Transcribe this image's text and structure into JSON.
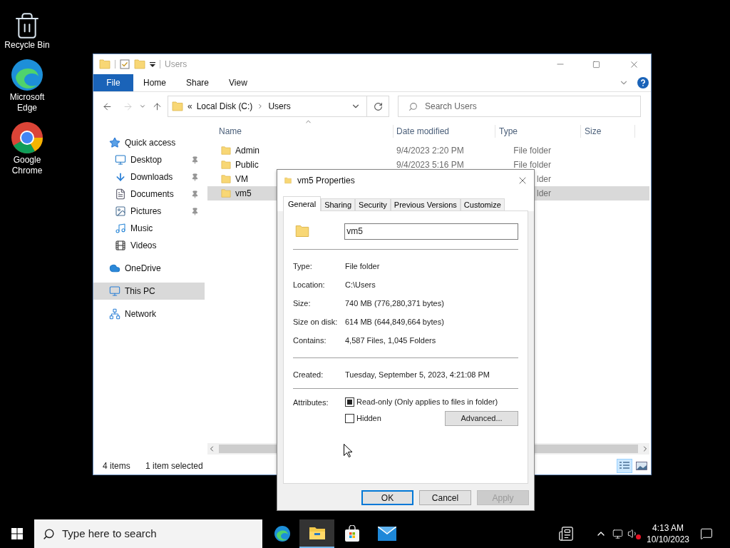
{
  "desktop_icons": [
    {
      "kind": "bin",
      "label": "Recycle Bin"
    },
    {
      "kind": "edge",
      "label": "Microsoft Edge"
    },
    {
      "kind": "chrome",
      "label": "Google Chrome"
    }
  ],
  "explorer": {
    "title": "Users",
    "ribbon_tabs": [
      {
        "label": "File",
        "kind": "file"
      },
      {
        "label": "Home",
        "kind": "tab"
      },
      {
        "label": "Share",
        "kind": "tab"
      },
      {
        "label": "View",
        "kind": "tab"
      }
    ],
    "breadcrumb_overflow": "«",
    "breadcrumb": [
      "Local Disk (C:)",
      "Users"
    ],
    "search": {
      "placeholder": "Search Users"
    },
    "columns": [
      "Name",
      "Date modified",
      "Type",
      "Size"
    ],
    "sidebar": [
      {
        "label": "Quick access",
        "kind": "star",
        "selected": false,
        "pinned": false,
        "children": [
          {
            "label": "Desktop",
            "kind": "desktop",
            "selected": false,
            "pinned": true
          },
          {
            "label": "Downloads",
            "kind": "download",
            "selected": false,
            "pinned": true
          },
          {
            "label": "Documents",
            "kind": "document",
            "selected": false,
            "pinned": true
          },
          {
            "label": "Pictures",
            "kind": "picture",
            "selected": false,
            "pinned": true
          },
          {
            "label": "Music",
            "kind": "music",
            "selected": false,
            "pinned": false
          },
          {
            "label": "Videos",
            "kind": "video",
            "selected": false,
            "pinned": false
          }
        ]
      },
      {
        "label": "OneDrive",
        "kind": "cloud",
        "selected": false,
        "pinned": false
      },
      {
        "label": "This PC",
        "kind": "pc",
        "selected": true,
        "pinned": false
      },
      {
        "label": "Network",
        "kind": "network",
        "selected": false,
        "pinned": false
      }
    ],
    "rows": [
      {
        "name": "Admin",
        "date_modified": "9/4/2023 2:20 PM",
        "type": "File folder",
        "selected": false
      },
      {
        "name": "Public",
        "date_modified": "9/4/2023 5:16 PM",
        "type": "File folder",
        "selected": false
      },
      {
        "name": "VM",
        "type": "lder",
        "selected": false
      },
      {
        "name": "vm5",
        "type": "lder",
        "selected": true
      }
    ],
    "status": {
      "items": "4 items",
      "selection": "1 item selected"
    },
    "views": [
      {
        "kind": "details",
        "selected": true
      },
      {
        "kind": "large",
        "selected": false
      }
    ]
  },
  "dialog": {
    "title": "vm5 Properties",
    "tabs": [
      {
        "label": "General",
        "selected": true
      },
      {
        "label": "Sharing",
        "selected": false
      },
      {
        "label": "Security",
        "selected": false
      },
      {
        "label": "Previous Versions",
        "selected": false
      },
      {
        "label": "Customize",
        "selected": false
      }
    ],
    "name_value": "vm5",
    "sections": [
      [
        {
          "label": "Type:",
          "value": "File folder"
        },
        {
          "label": "Location:",
          "value": "C:\\Users"
        },
        {
          "label": "Size:",
          "value": "740 MB (776,280,371 bytes)"
        },
        {
          "label": "Size on disk:",
          "value": "614 MB (644,849,664 bytes)"
        },
        {
          "label": "Contains:",
          "value": "4,587 Files, 1,045 Folders"
        }
      ],
      [
        {
          "label": "Created:",
          "value": "Tuesday, September 5, 2023, 4:21:08 PM"
        }
      ]
    ],
    "attributes_label": "Attributes:",
    "attributes": [
      {
        "label": "Read-only (Only applies to files in folder)",
        "checked": true
      },
      {
        "label": "Hidden",
        "checked": false
      }
    ],
    "advanced_button": "Advanced...",
    "buttons": [
      {
        "label": "OK",
        "default": true,
        "disabled": false
      },
      {
        "label": "Cancel",
        "default": false,
        "disabled": false
      },
      {
        "label": "Apply",
        "default": false,
        "disabled": true
      }
    ]
  },
  "taskbar": {
    "search": {
      "placeholder": "Type here to search"
    },
    "apps": [
      {
        "kind": "edge",
        "active": false
      },
      {
        "kind": "explorer",
        "active": true
      },
      {
        "kind": "store",
        "active": false
      },
      {
        "kind": "mail",
        "active": false
      }
    ],
    "time": "4:13 AM",
    "date": "10/10/2023"
  }
}
